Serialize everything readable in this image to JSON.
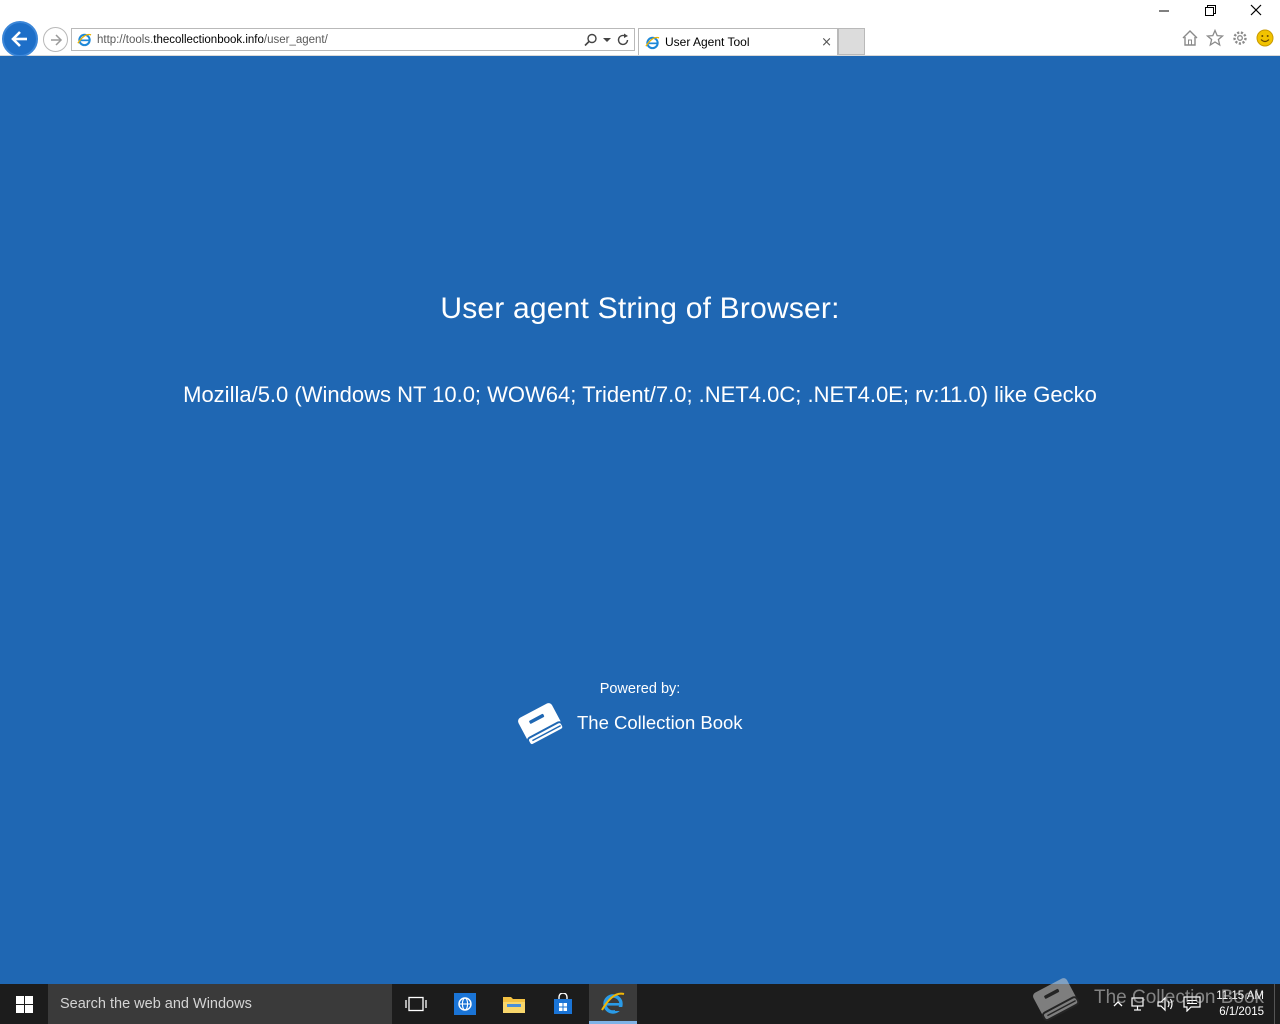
{
  "browser": {
    "url_prefix": "http://tools.",
    "url_domain": "thecollectionbook.info",
    "url_path": "/user_agent/",
    "tab_title": "User Agent Tool",
    "tab_close_glyph": "×"
  },
  "page": {
    "heading": "User agent String of Browser:",
    "user_agent": "Mozilla/5.0 (Windows NT 10.0; WOW64; Trident/7.0; .NET4.0C; .NET4.0E; rv:11.0) like Gecko",
    "powered_by": "Powered by:",
    "brand_name": "The Collection Book",
    "background_color": "#1f67b3"
  },
  "taskbar": {
    "search_placeholder": "Search the web and Windows",
    "time": "11:15 AM",
    "date": "6/1/2015",
    "watermark": "The Collection Book"
  }
}
